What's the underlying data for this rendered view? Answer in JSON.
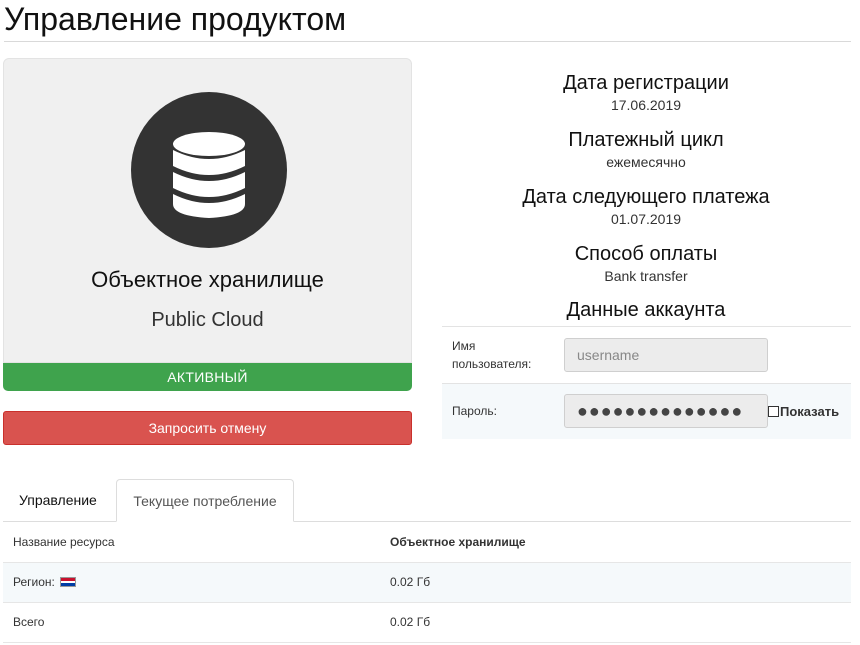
{
  "page": {
    "title": "Управление продуктом"
  },
  "product": {
    "icon": "database-icon",
    "name": "Объектное хранилище",
    "group": "Public Cloud",
    "status": "АКТИВНЫЙ",
    "cancel_label": "Запросить отмену"
  },
  "info": {
    "registration_label": "Дата регистрации",
    "registration_value": "17.06.2019",
    "cycle_label": "Платежный цикл",
    "cycle_value": "ежемесячно",
    "next_payment_label": "Дата следующего платежа",
    "next_payment_value": "01.07.2019",
    "method_label": "Способ оплаты",
    "method_value": "Bank transfer"
  },
  "account": {
    "title": "Данные аккаунта",
    "username_label_1": "Имя",
    "username_label_2": "пользователя:",
    "username_value": "username",
    "password_label": "Пароль:",
    "password_value": "●●●●●●●●●●●●●●",
    "show_label": "Показать"
  },
  "tabs": [
    {
      "label": "Управление"
    },
    {
      "label": "Текущее потребление"
    }
  ],
  "usage": {
    "header": {
      "resource": "Название ресурса",
      "value": "Объектное хранилище"
    },
    "rows": [
      {
        "name": "Регион:",
        "value": "0.02 Гб"
      },
      {
        "name": "Всего",
        "value": "0.02 Гб"
      }
    ]
  },
  "colors": {
    "active": "#3fa34d",
    "danger": "#d9534f",
    "icon_bg": "#333333"
  }
}
